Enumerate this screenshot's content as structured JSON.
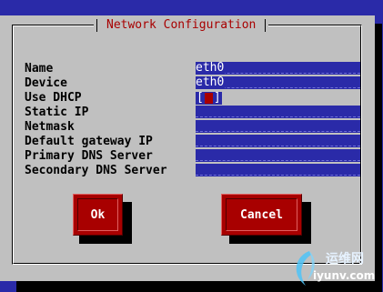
{
  "dialog": {
    "title": "Network Configuration"
  },
  "form": {
    "labels": [
      "Name",
      "Device",
      "Use DHCP",
      "Static IP",
      "Netmask",
      "Default gateway IP",
      "Primary DNS Server",
      "Secondary DNS Server"
    ],
    "name_value": "eth0",
    "device_value": "eth0",
    "dhcp_checked": true,
    "dhcp_open_bracket": "[",
    "dhcp_close_bracket": "]",
    "static_ip_value": "",
    "netmask_value": "",
    "gateway_value": "",
    "primary_dns_value": "",
    "secondary_dns_value": ""
  },
  "buttons": {
    "ok_label": "Ok",
    "cancel_label": "Cancel"
  },
  "watermark": {
    "cn": "运维网",
    "url": "iyunv.com"
  },
  "colors": {
    "background": "#2a2aa8",
    "dialog": "#c0c0c0",
    "title": "#a80000",
    "button": "#a80000",
    "field": "#2a2aa8"
  }
}
